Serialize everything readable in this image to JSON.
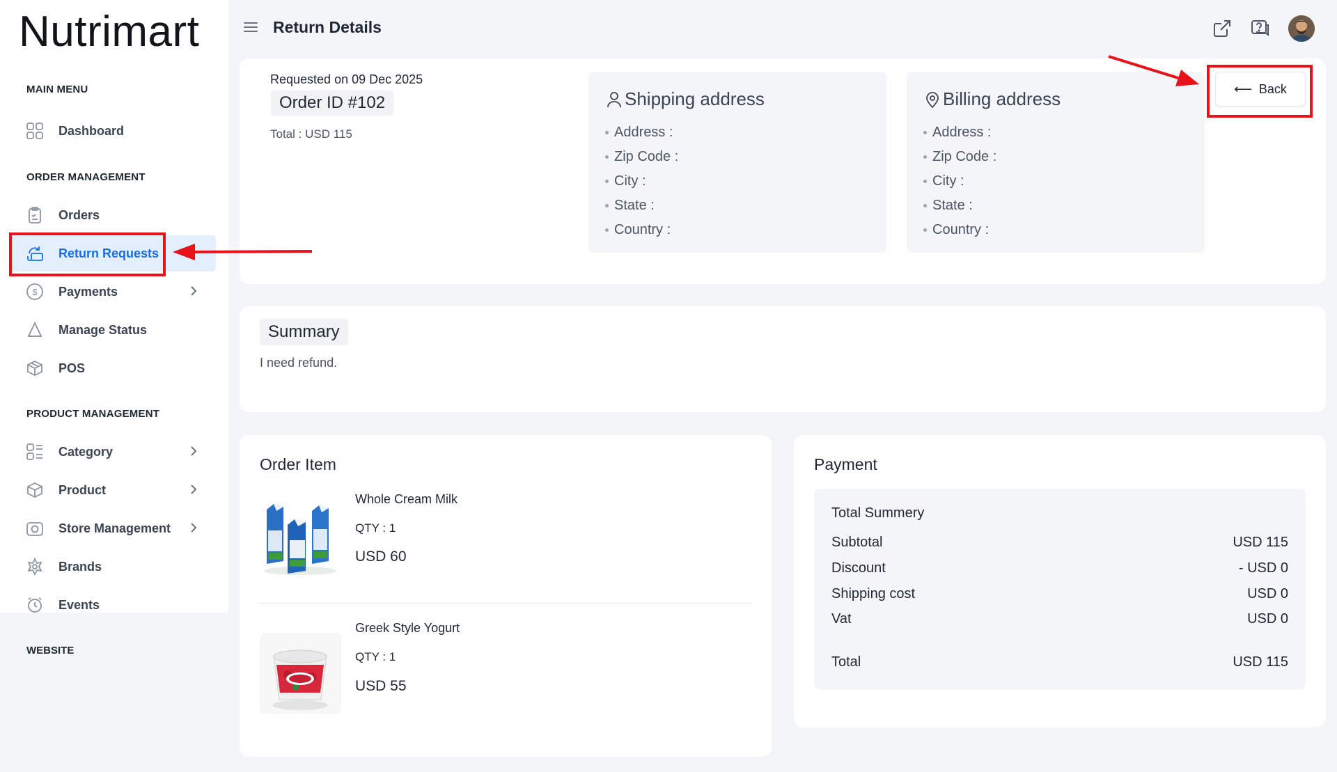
{
  "brand": "Nutrimart",
  "sidebar": {
    "main_menu_label": "MAIN MENU",
    "order_mgmt_label": "ORDER MANAGEMENT",
    "product_mgmt_label": "PRODUCT MANAGEMENT",
    "website_label": "WEBSITE",
    "items": {
      "dashboard": "Dashboard",
      "orders": "Orders",
      "return_requests": "Return Requests",
      "payments": "Payments",
      "manage_status": "Manage Status",
      "pos": "POS",
      "category": "Category",
      "product": "Product",
      "store_management": "Store Management",
      "brands": "Brands",
      "events": "Events"
    },
    "active_item": "Return Requests"
  },
  "header": {
    "title": "Return Details",
    "icons": [
      "external-link-icon",
      "chat-support-icon",
      "avatar"
    ]
  },
  "order": {
    "requested_on": "Requested on 09 Dec 2025",
    "order_id": "Order ID #102",
    "total": "Total : USD 115",
    "back_label": "Back"
  },
  "shipping": {
    "title": "Shipping address",
    "fields": [
      "Address :",
      "Zip Code :",
      "City :",
      "State :",
      "Country :"
    ]
  },
  "billing": {
    "title": "Billing address",
    "fields": [
      "Address :",
      "Zip Code :",
      "City :",
      "State :",
      "Country :"
    ]
  },
  "summary": {
    "title": "Summary",
    "text": "I need refund."
  },
  "order_items": {
    "title": "Order Item",
    "items": [
      {
        "name": "Whole Cream Milk",
        "qty": "QTY : 1",
        "price": "USD 60"
      },
      {
        "name": "Greek Style Yogurt",
        "qty": "QTY : 1",
        "price": "USD 55"
      }
    ]
  },
  "payment": {
    "title": "Payment",
    "summary_title": "Total Summery",
    "rows": [
      {
        "label": "Subtotal",
        "value": "USD 115"
      },
      {
        "label": "Discount",
        "value": "- USD 0"
      },
      {
        "label": "Shipping cost",
        "value": "USD 0"
      },
      {
        "label": "Vat",
        "value": "USD 0"
      }
    ],
    "total_label": "Total",
    "total_value": "USD 115"
  },
  "colors": {
    "accent": "#1a6fe0",
    "active_bg": "#e3effd",
    "annotation": "#e8121b",
    "page_bg": "#f4f5f8"
  }
}
